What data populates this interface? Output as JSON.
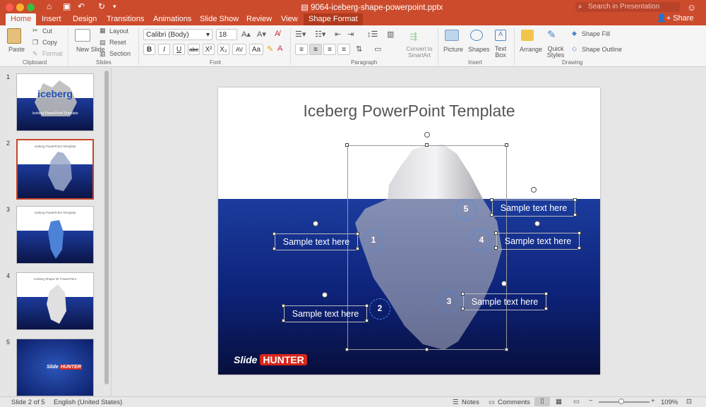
{
  "window": {
    "doc_title": "9064-iceberg-shape-powerpoint.pptx",
    "search_placeholder": "Search in Presentation",
    "share_label": "Share"
  },
  "tabs": [
    "Home",
    "Insert",
    "Design",
    "Transitions",
    "Animations",
    "Slide Show",
    "Review",
    "View",
    "Shape Format"
  ],
  "ribbon": {
    "clipboard": {
      "paste": "Paste",
      "cut": "Cut",
      "copy": "Copy",
      "format": "Format",
      "group": "Clipboard"
    },
    "slides": {
      "new_slide": "New Slide",
      "layout": "Layout",
      "reset": "Reset",
      "section": "Section",
      "group": "Slides"
    },
    "font": {
      "font_name": "Calibri (Body)",
      "font_size": "18",
      "group": "Font"
    },
    "paragraph": {
      "convert": "Convert to SmartArt",
      "group": "Paragraph"
    },
    "insert": {
      "picture": "Picture",
      "shapes": "Shapes",
      "text_box": "Text Box",
      "group": "Insert"
    },
    "drawing": {
      "arrange": "Arrange",
      "quick_styles": "Quick Styles",
      "shape_fill": "Shape Fill",
      "shape_outline": "Shape Outline",
      "group": "Drawing"
    }
  },
  "thumbnails": [
    {
      "num": "1",
      "title": "iceberg",
      "subtitle": "Iceberg PowerPoint Template"
    },
    {
      "num": "2",
      "title": "Iceberg PowerPoint Template"
    },
    {
      "num": "3",
      "title": "Iceberg PowerPoint Template"
    },
    {
      "num": "4",
      "title": "Iceberg Shape for PowerPoint"
    },
    {
      "num": "5",
      "title": ""
    }
  ],
  "slide": {
    "title": "Iceberg PowerPoint Template",
    "sample": "Sample text here",
    "numbers": [
      "1",
      "2",
      "3",
      "4",
      "5"
    ],
    "logo_a": "Slide",
    "logo_b": "HUNTER"
  },
  "status": {
    "slide_of": "Slide 2 of 5",
    "language": "English (United States)",
    "notes": "Notes",
    "comments": "Comments",
    "zoom": "109%"
  },
  "colors": {
    "accent": "#cc4b2c",
    "sea_top": "#1b3c9e",
    "sea_bottom": "#080f3c"
  }
}
